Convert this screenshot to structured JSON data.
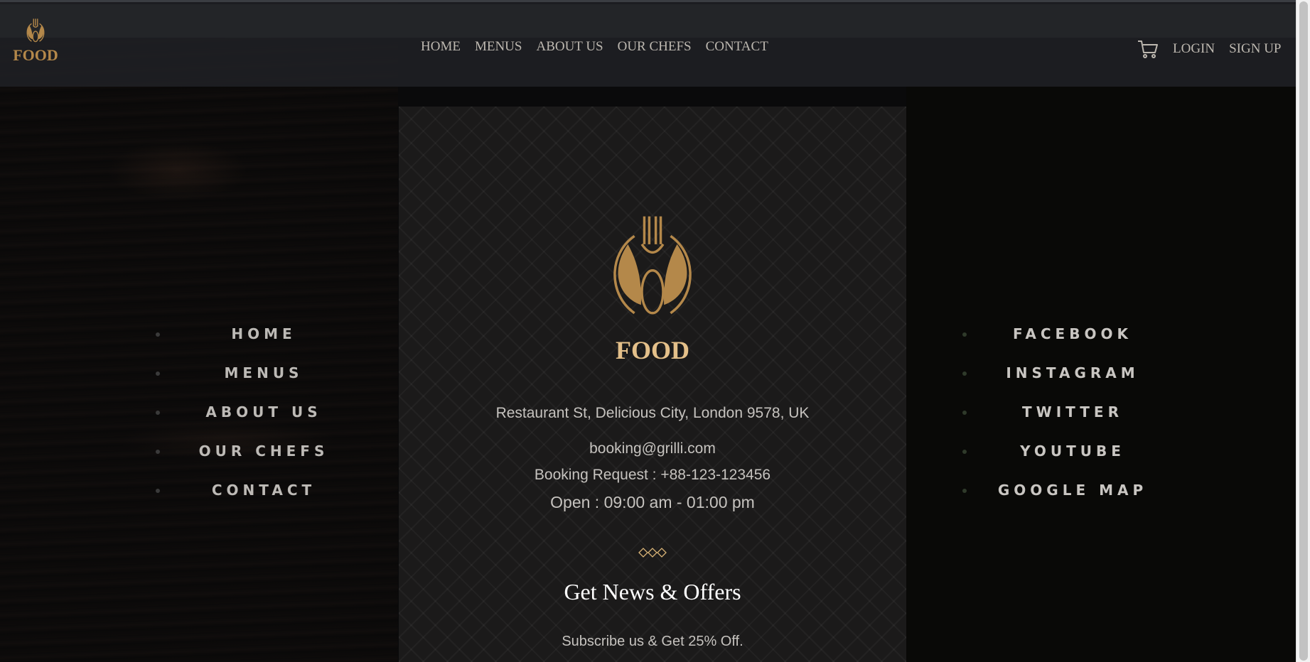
{
  "header": {
    "brand": "FOOD",
    "nav": [
      "HOME",
      "MENUS",
      "ABOUT US",
      "OUR CHEFS",
      "CONTACT"
    ],
    "cart_icon": "shopping-cart-icon",
    "login": "LOGIN",
    "signup": "SIGN UP"
  },
  "panel": {
    "title": "FOOD",
    "logo_icon": "fork-spoon-icon",
    "address": "Restaurant St, Delicious City, London 9578, UK",
    "email": "booking@grilli.com",
    "phone": "Booking Request : +88-123-123456",
    "hours": "Open : 09:00 am - 01:00 pm",
    "separator_icon": "diamonds-icon",
    "newsletter_title": "Get News & Offers",
    "newsletter_subtitle": "Subscribe us & Get 25% Off."
  },
  "footer_nav": [
    "HOME",
    "MENUS",
    "ABOUT US",
    "OUR CHEFS",
    "CONTACT"
  ],
  "social": [
    "FACEBOOK",
    "INSTAGRAM",
    "TWITTER",
    "YOUTUBE",
    "GOOGLE MAP"
  ],
  "colors": {
    "accent": "#b4884a",
    "accent_light": "#e4c08a",
    "panel": "#1b1a1a"
  }
}
